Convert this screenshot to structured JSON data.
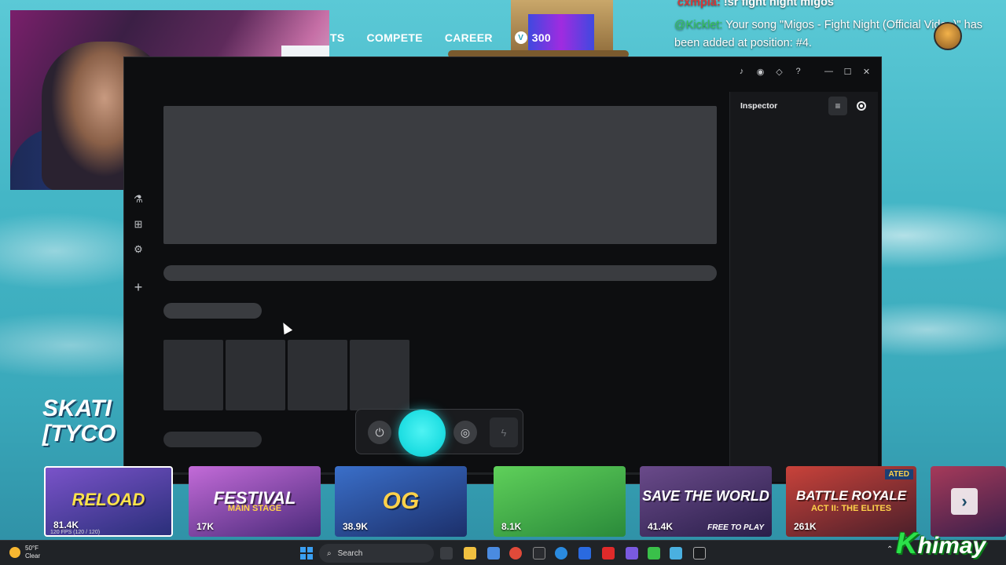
{
  "game_nav": {
    "partial_item": "TS",
    "compete": "COMPETE",
    "career": "CAREER",
    "vbucks_symbol": "V",
    "vbucks_count": "300"
  },
  "chat": {
    "line1_user": "cxmpla:",
    "line1_text": " !sr fight night migos",
    "line2_user": "@Kicklet:",
    "line2_text": " Your song \"Migos - Fight Night (Official Video)\" has been added at position: #4."
  },
  "left_title": {
    "line1": "SKATI",
    "line2": "[TYCO"
  },
  "window": {
    "titlebar_icons": [
      "bell-icon",
      "discord-icon",
      "diamond-icon",
      "help-icon",
      "minimize-icon",
      "maximize-icon",
      "close-icon"
    ],
    "titlebar_glyphs": {
      "bell": "♪",
      "discord": "◉",
      "diamond": "◇",
      "help": "?",
      "minimize": "—",
      "maximize": "☐",
      "close": "✕"
    },
    "sidebar_glyphs": {
      "flask": "⚗",
      "package": "⊞",
      "settings": "⚙",
      "add": "+",
      "user": "☺"
    },
    "inspector": {
      "title": "Inspector",
      "sliders_glyph": "≡"
    }
  },
  "voicebar": {
    "power_glyph": "⏻",
    "ear_glyph": "◎",
    "bolt_glyph": "ϟ",
    "accent": "#20dfe3"
  },
  "tiles": [
    {
      "name": "RELOAD",
      "sub": "",
      "count": "81.4K",
      "fps": "120 FPS (120 / 120)",
      "tag": ""
    },
    {
      "name": "FESTIVAL",
      "sub": "MAIN STAGE",
      "count": "17K",
      "tag": ""
    },
    {
      "name": "OG",
      "sub": "",
      "count": "38.9K",
      "tag": ""
    },
    {
      "name": "",
      "sub": "",
      "count": "8.1K",
      "tag": ""
    },
    {
      "name": "SAVE THE WORLD",
      "sub": "",
      "count": "41.4K",
      "ftp": "FREE TO PLAY",
      "tag": ""
    },
    {
      "name": "BATTLE ROYALE",
      "sub": "ACT II: THE ELITES",
      "count": "261K",
      "tag": "ATED"
    },
    {
      "name": "",
      "sub": "",
      "count": "",
      "tag": ""
    }
  ],
  "next_arrow": "›",
  "taskbar": {
    "temp": "50°F",
    "condition": "Clear",
    "search_placeholder": "Search"
  },
  "watermark": {
    "k": "K",
    "rest": "himay"
  },
  "colors": {
    "window_bg": "#0d0e10",
    "skeleton": "#3b3d41",
    "accent_cyan": "#20dfe3",
    "chat_user_green": "#35c35b",
    "chat_user_red": "#d23a3a"
  }
}
